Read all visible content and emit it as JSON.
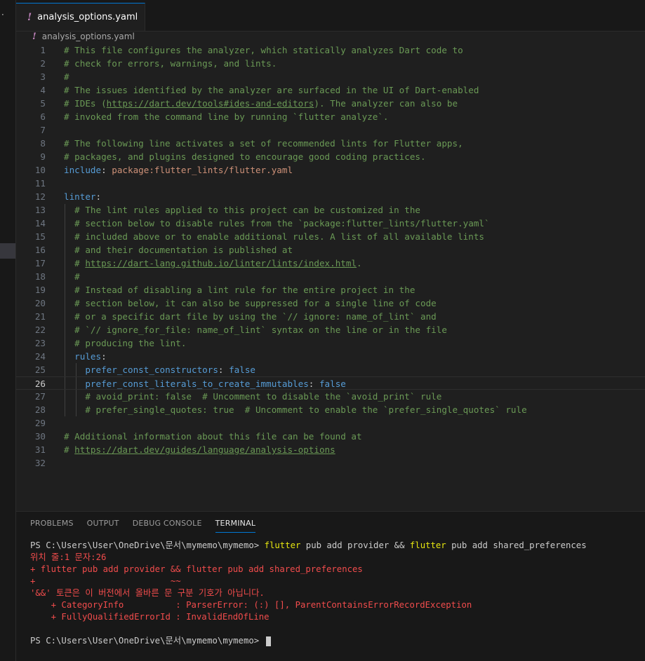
{
  "tab": {
    "label": "analysis_options.yaml",
    "icon": "exclamation-icon"
  },
  "breadcrumb": {
    "label": "analysis_options.yaml"
  },
  "editor": {
    "current_line": 26,
    "lines": [
      {
        "n": "1",
        "segs": [
          [
            "c",
            "# This file configures the analyzer, which statically analyzes Dart code to"
          ]
        ]
      },
      {
        "n": "2",
        "segs": [
          [
            "c",
            "# check for errors, warnings, and lints."
          ]
        ]
      },
      {
        "n": "3",
        "segs": [
          [
            "c",
            "#"
          ]
        ]
      },
      {
        "n": "4",
        "segs": [
          [
            "c",
            "# The issues identified by the analyzer are surfaced in the UI of Dart-enabled"
          ]
        ]
      },
      {
        "n": "5",
        "segs": [
          [
            "c",
            "# IDEs ("
          ],
          [
            "u",
            "https://dart.dev/tools#ides-and-editors"
          ],
          [
            "c",
            "). The analyzer can also be"
          ]
        ]
      },
      {
        "n": "6",
        "segs": [
          [
            "c",
            "# invoked from the command line by running `flutter analyze`."
          ]
        ]
      },
      {
        "n": "7",
        "segs": []
      },
      {
        "n": "8",
        "segs": [
          [
            "c",
            "# The following line activates a set of recommended lints for Flutter apps,"
          ]
        ]
      },
      {
        "n": "9",
        "segs": [
          [
            "c",
            "# packages, and plugins designed to encourage good coding practices."
          ]
        ]
      },
      {
        "n": "10",
        "segs": [
          [
            "k",
            "include"
          ],
          [
            "p",
            ": "
          ],
          [
            "s",
            "package:flutter_lints/flutter.yaml"
          ]
        ]
      },
      {
        "n": "11",
        "segs": []
      },
      {
        "n": "12",
        "segs": [
          [
            "k",
            "linter"
          ],
          [
            "p",
            ":"
          ]
        ]
      },
      {
        "n": "13",
        "segs": [
          [
            "p",
            "  "
          ],
          [
            "c",
            "# The lint rules applied to this project can be customized in the"
          ]
        ]
      },
      {
        "n": "14",
        "segs": [
          [
            "p",
            "  "
          ],
          [
            "c",
            "# section below to disable rules from the `package:flutter_lints/flutter.yaml`"
          ]
        ]
      },
      {
        "n": "15",
        "segs": [
          [
            "p",
            "  "
          ],
          [
            "c",
            "# included above or to enable additional rules. A list of all available lints"
          ]
        ]
      },
      {
        "n": "16",
        "segs": [
          [
            "p",
            "  "
          ],
          [
            "c",
            "# and their documentation is published at"
          ]
        ]
      },
      {
        "n": "17",
        "segs": [
          [
            "p",
            "  "
          ],
          [
            "c",
            "# "
          ],
          [
            "u",
            "https://dart-lang.github.io/linter/lints/index.html"
          ],
          [
            "c",
            "."
          ]
        ]
      },
      {
        "n": "18",
        "segs": [
          [
            "p",
            "  "
          ],
          [
            "c",
            "#"
          ]
        ]
      },
      {
        "n": "19",
        "segs": [
          [
            "p",
            "  "
          ],
          [
            "c",
            "# Instead of disabling a lint rule for the entire project in the"
          ]
        ]
      },
      {
        "n": "20",
        "segs": [
          [
            "p",
            "  "
          ],
          [
            "c",
            "# section below, it can also be suppressed for a single line of code"
          ]
        ]
      },
      {
        "n": "21",
        "segs": [
          [
            "p",
            "  "
          ],
          [
            "c",
            "# or a specific dart file by using the `// ignore: name_of_lint` and"
          ]
        ]
      },
      {
        "n": "22",
        "segs": [
          [
            "p",
            "  "
          ],
          [
            "c",
            "# `// ignore_for_file: name_of_lint` syntax on the line or in the file"
          ]
        ]
      },
      {
        "n": "23",
        "segs": [
          [
            "p",
            "  "
          ],
          [
            "c",
            "# producing the lint."
          ]
        ]
      },
      {
        "n": "24",
        "segs": [
          [
            "p",
            "  "
          ],
          [
            "k",
            "rules"
          ],
          [
            "p",
            ":"
          ]
        ]
      },
      {
        "n": "25",
        "segs": [
          [
            "p",
            "    "
          ],
          [
            "k",
            "prefer_const_constructors"
          ],
          [
            "p",
            ": "
          ],
          [
            "k",
            "false"
          ]
        ]
      },
      {
        "n": "26",
        "segs": [
          [
            "p",
            "    "
          ],
          [
            "k",
            "prefer_const_literals_to_create_immutables"
          ],
          [
            "p",
            ": "
          ],
          [
            "k",
            "false"
          ]
        ]
      },
      {
        "n": "27",
        "segs": [
          [
            "p",
            "    "
          ],
          [
            "c",
            "# avoid_print: false  # Uncomment to disable the `avoid_print` rule"
          ]
        ]
      },
      {
        "n": "28",
        "segs": [
          [
            "p",
            "    "
          ],
          [
            "c",
            "# prefer_single_quotes: true  # Uncomment to enable the `prefer_single_quotes` rule"
          ]
        ]
      },
      {
        "n": "29",
        "segs": []
      },
      {
        "n": "30",
        "segs": [
          [
            "c",
            "# Additional information about this file can be found at"
          ]
        ]
      },
      {
        "n": "31",
        "segs": [
          [
            "c",
            "# "
          ],
          [
            "u",
            "https://dart.dev/guides/language/analysis-options"
          ]
        ]
      },
      {
        "n": "32",
        "segs": []
      }
    ]
  },
  "panel": {
    "tabs": [
      "PROBLEMS",
      "OUTPUT",
      "DEBUG CONSOLE",
      "TERMINAL"
    ],
    "active_tab": "TERMINAL"
  },
  "terminal": {
    "lines": [
      [
        [
          "white",
          "PS C:\\Users\\User\\OneDrive\\문서\\mymemo\\mymemo> "
        ],
        [
          "yellow",
          "flutter"
        ],
        [
          "white",
          " pub add provider && "
        ],
        [
          "yellow",
          "flutter"
        ],
        [
          "white",
          " pub add shared_preferences"
        ]
      ],
      [
        [
          "red",
          "위치 줄:1 문자:26"
        ]
      ],
      [
        [
          "red",
          "+ flutter pub add provider && flutter pub add shared_preferences"
        ]
      ],
      [
        [
          "red",
          "+                          ~~"
        ]
      ],
      [
        [
          "red",
          "'&&' 토큰은 이 버전에서 올바른 문 구분 기호가 아닙니다."
        ]
      ],
      [
        [
          "red",
          "    + CategoryInfo          : ParserError: (:) [], ParentContainsErrorRecordException"
        ]
      ],
      [
        [
          "red",
          "    + FullyQualifiedErrorId : InvalidEndOfLine"
        ]
      ],
      [],
      [
        [
          "white",
          "PS C:\\Users\\User\\OneDrive\\문서\\mymemo\\mymemo> "
        ]
      ]
    ]
  },
  "colors": {
    "accent": "#0078d4",
    "comment": "#6a9955",
    "keyword": "#569cd6",
    "string": "#ce9178",
    "error": "#f14c4c",
    "command": "#e5e510"
  }
}
